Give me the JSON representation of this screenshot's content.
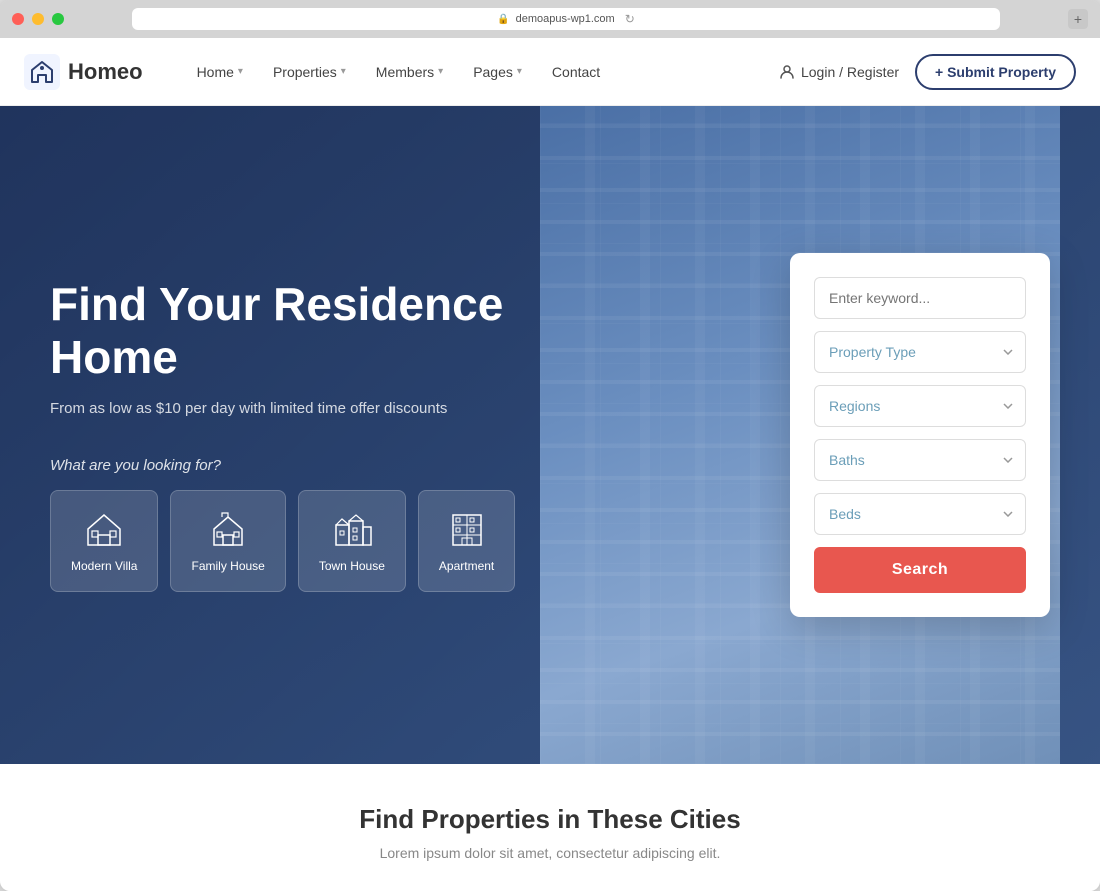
{
  "browser": {
    "url": "demoapus-wp1.com",
    "tab_label": "+"
  },
  "navbar": {
    "logo_text": "Homeo",
    "nav_items": [
      {
        "label": "Home",
        "has_dropdown": true
      },
      {
        "label": "Properties",
        "has_dropdown": true
      },
      {
        "label": "Members",
        "has_dropdown": true
      },
      {
        "label": "Pages",
        "has_dropdown": true
      },
      {
        "label": "Contact",
        "has_dropdown": false
      }
    ],
    "login_label": "Login / Register",
    "submit_label": "+ Submit Property"
  },
  "hero": {
    "title": "Find Your Residence Home",
    "subtitle": "From as low as $10 per day with limited time offer discounts",
    "question": "What are you looking for?",
    "property_types": [
      {
        "label": "Modern Villa",
        "icon": "villa"
      },
      {
        "label": "Family House",
        "icon": "house"
      },
      {
        "label": "Town House",
        "icon": "townhouse"
      },
      {
        "label": "Apartment",
        "icon": "apartment"
      }
    ]
  },
  "search_panel": {
    "keyword_placeholder": "Enter keyword...",
    "property_type_label": "Property Type",
    "regions_label": "Regions",
    "baths_label": "Baths",
    "beds_label": "Beds",
    "search_button_label": "Search"
  },
  "bottom": {
    "title": "Find Properties in These Cities",
    "subtitle": "Lorem ipsum dolor sit amet, consectetur adipiscing elit."
  }
}
